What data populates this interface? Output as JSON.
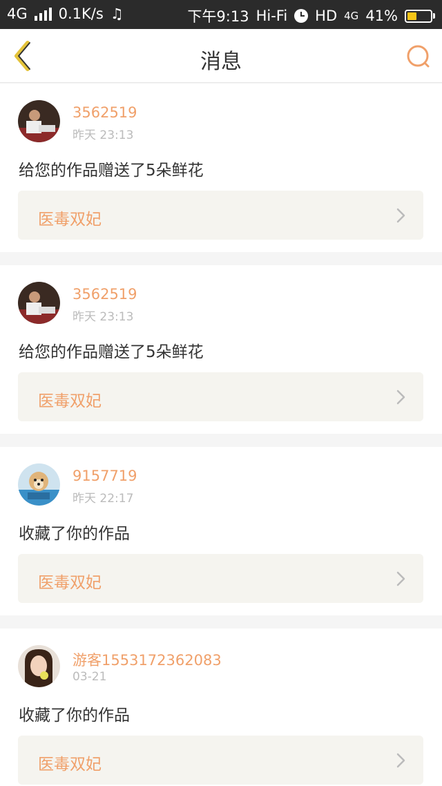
{
  "status_bar": {
    "network": "4G",
    "speed": "0.1K/s",
    "music_icon": "♫",
    "time": "下午9:13",
    "wifi": "Hi-Fi",
    "hd": "HD",
    "network2": "4G",
    "battery": "41%",
    "battery_level": 0.41,
    "battery_color": "#f5c518"
  },
  "header": {
    "title": "消息",
    "back_icon": "chevron-left-icon",
    "search_icon": "search-icon",
    "accent_color": "#f0a06a"
  },
  "messages": [
    {
      "username": "3562519",
      "time": "昨天 23:13",
      "text": "给您的作品赠送了5朵鲜花",
      "work": "医毒双妃"
    },
    {
      "username": "3562519",
      "time": "昨天 23:13",
      "text": "给您的作品赠送了5朵鲜花",
      "work": "医毒双妃"
    },
    {
      "username": "9157719",
      "time": "昨天 22:17",
      "text": "收藏了你的作品",
      "work": "医毒双妃"
    },
    {
      "username": "游客1553172362083",
      "time": "03-21",
      "text": "收藏了你的作品",
      "work": "医毒双妃"
    }
  ]
}
